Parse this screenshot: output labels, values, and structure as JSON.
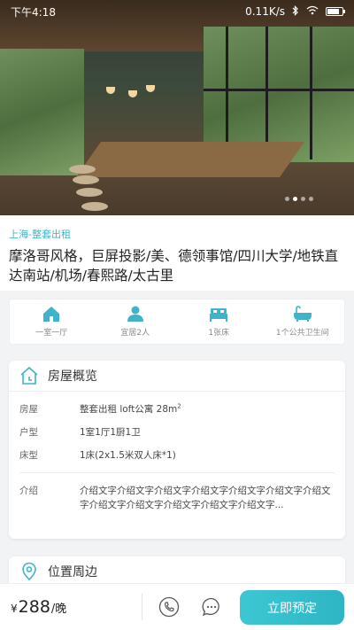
{
  "status_bar": {
    "time": "下午4:18",
    "network_speed": "0.11K/s"
  },
  "hero": {
    "slide_count": 4,
    "active_slide": 2
  },
  "listing": {
    "tag": "上海-整套出租",
    "title": "摩洛哥风格，巨屏投影/美、德领事馆/四川大学/地铁直达南站/机场/春熙路/太古里"
  },
  "facilities": [
    {
      "icon": "house-icon",
      "label": "一室一厅"
    },
    {
      "icon": "people-icon",
      "label": "宜居2人"
    },
    {
      "icon": "bed-icon",
      "label": "1张床"
    },
    {
      "icon": "bathtub-icon",
      "label": "1个公共卫生间"
    }
  ],
  "overview": {
    "heading": "房屋概览",
    "rows": [
      {
        "key": "房屋",
        "value": "整套出租 loft公寓 28m",
        "sup": "2"
      },
      {
        "key": "户型",
        "value": "1室1厅1厨1卫"
      },
      {
        "key": "床型",
        "value": "1床(2x1.5米双人床*1)"
      }
    ],
    "intro_key": "介绍",
    "intro_value": "介绍文字介绍文字介绍文字介绍文字介绍文字介绍文字介绍文字介绍文字介绍文字介绍文字介绍文字介绍文字..."
  },
  "location": {
    "heading": "位置周边"
  },
  "bottom_bar": {
    "currency": "¥",
    "price": "288",
    "unit": "/晚",
    "book_label": "立即预定"
  },
  "colors": {
    "accent": "#3fb3c7",
    "button": "#32bdcb"
  }
}
